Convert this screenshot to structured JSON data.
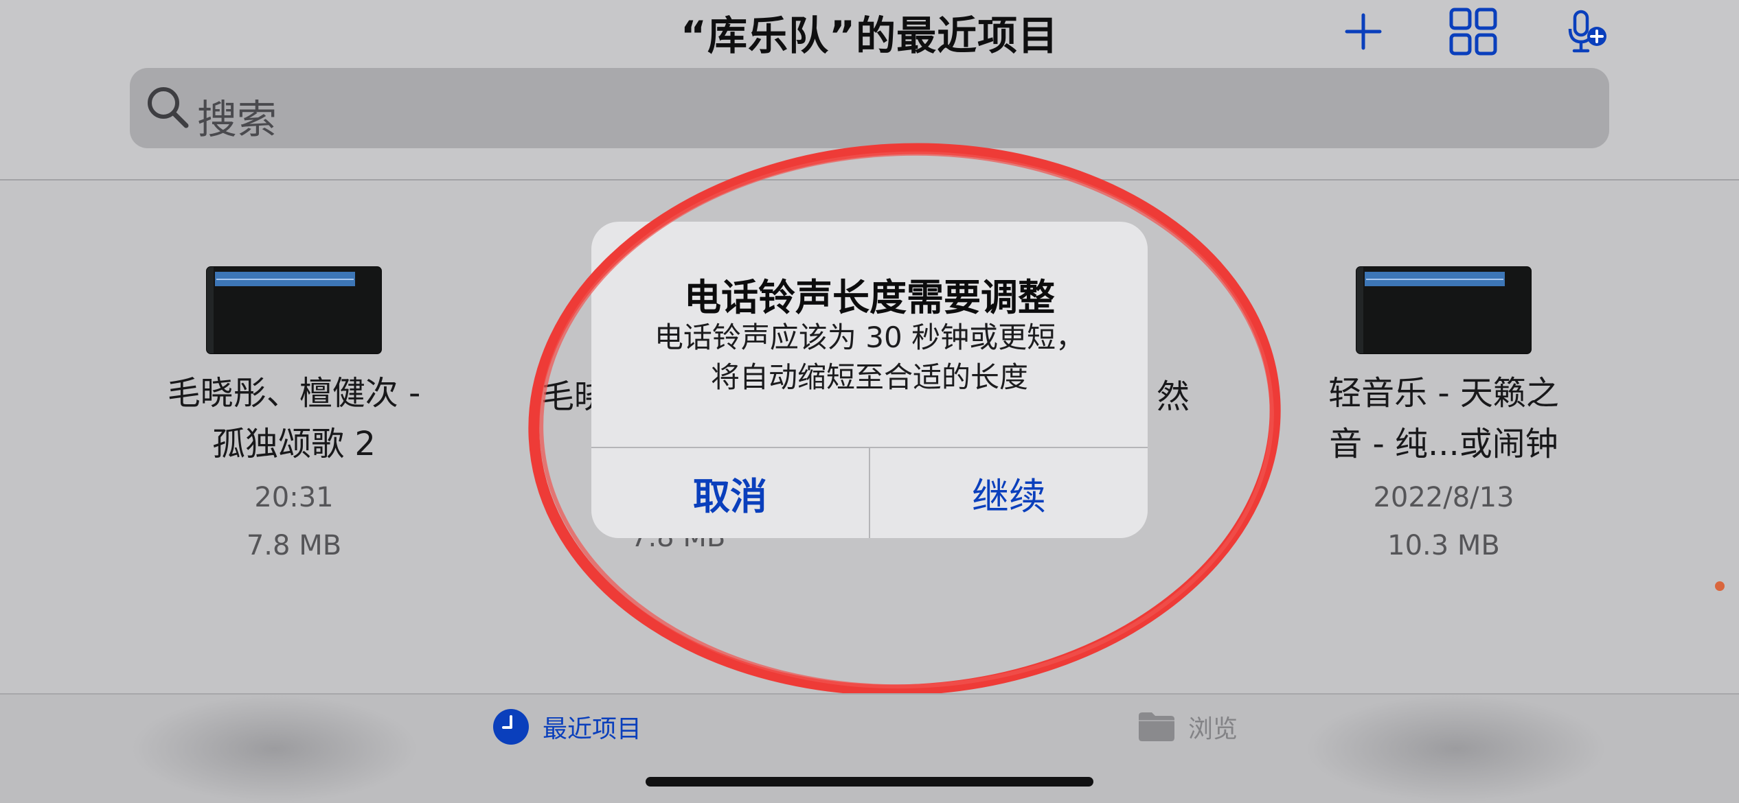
{
  "header": {
    "title": "“库乐队”的最近项目",
    "add_icon": "plus-icon",
    "grid_icon": "grid-view-icon",
    "mic_icon": "mic-add-icon"
  },
  "search": {
    "placeholder": "搜索"
  },
  "documents": [
    {
      "name": "毛晓彤、檀健次 -\n孤独颂歌  2",
      "time": "20:31",
      "size": "7.8 MB"
    },
    {
      "name_partial_left": "毛晓",
      "name_partial_right": "然",
      "size": "7.8 MB"
    },
    {
      "name": "轻音乐 - 天籁之\n音 - 纯...或闹钟",
      "time": "2022/8/13",
      "size": "10.3 MB"
    }
  ],
  "alert": {
    "title": "电话铃声长度需要调整",
    "message": "电话铃声应该为 30 秒钟或更短，\n将自动缩短至合适的长度",
    "cancel_label": "取消",
    "continue_label": "继续"
  },
  "tabbar": {
    "recent_label": "最近项目",
    "browse_label": "浏览"
  },
  "colors": {
    "accent": "#0a3fbc",
    "annotation_red": "#ee3b37"
  }
}
